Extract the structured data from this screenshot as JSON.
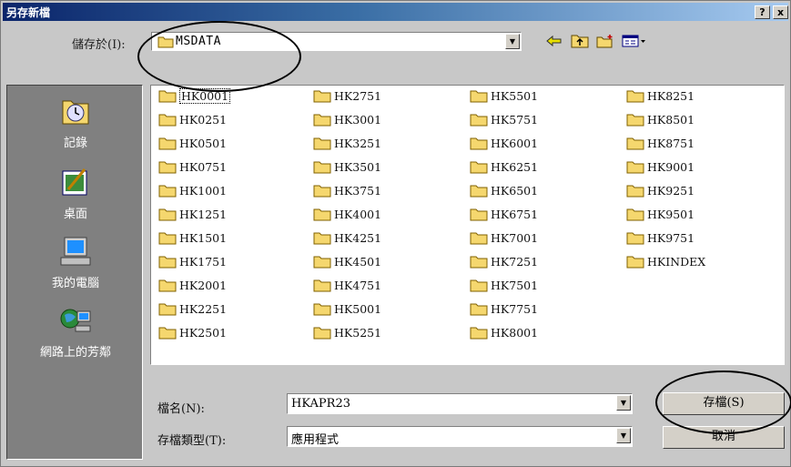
{
  "window": {
    "title": "另存新檔",
    "help_label": "?",
    "close_label": "x"
  },
  "toolbar": {
    "save_in_label": "儲存於(I):",
    "location": "MSDATA",
    "icons": [
      "back-arrow-icon",
      "up-folder-icon",
      "new-folder-icon",
      "view-menu-icon"
    ]
  },
  "places": [
    {
      "label": "記錄",
      "icon": "history-icon"
    },
    {
      "label": "桌面",
      "icon": "desktop-icon"
    },
    {
      "label": "我的電腦",
      "icon": "my-computer-icon"
    },
    {
      "label": "網路上的芳鄰",
      "icon": "network-places-icon"
    }
  ],
  "files": {
    "columns": [
      [
        "HK0001",
        "HK0251",
        "HK0501",
        "HK0751",
        "HK1001",
        "HK1251",
        "HK1501",
        "HK1751",
        "HK2001",
        "HK2251",
        "HK2501"
      ],
      [
        "HK2751",
        "HK3001",
        "HK3251",
        "HK3501",
        "HK3751",
        "HK4001",
        "HK4251",
        "HK4501",
        "HK4751",
        "HK5001",
        "HK5251"
      ],
      [
        "HK5501",
        "HK5751",
        "HK6001",
        "HK6251",
        "HK6501",
        "HK6751",
        "HK7001",
        "HK7251",
        "HK7501",
        "HK7751",
        "HK8001"
      ],
      [
        "HK8251",
        "HK8501",
        "HK8751",
        "HK9001",
        "HK9251",
        "HK9501",
        "HK9751",
        "HKINDEX"
      ]
    ]
  },
  "form": {
    "filename_label": "檔名(N):",
    "filename_value": "HKAPR23",
    "filetype_label": "存檔類型(T):",
    "filetype_value": "應用程式"
  },
  "buttons": {
    "save_label": "存檔(S)",
    "cancel_label": "取消"
  },
  "colors": {
    "folder": "#f5d76e",
    "title_start": "#0a246a",
    "title_end": "#a6caf0"
  }
}
